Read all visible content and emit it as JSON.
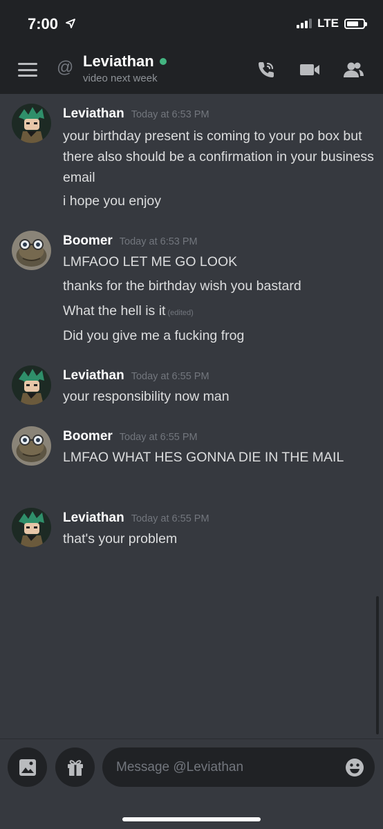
{
  "status_bar": {
    "time": "7:00",
    "network": "LTE"
  },
  "header": {
    "channel_name": "Leviathan",
    "topic": "video next week",
    "at_symbol": "@"
  },
  "messages": [
    {
      "author": "Leviathan",
      "timestamp": "Today at 6:53 PM",
      "lines": [
        "your birthday present is coming to your po box but there also should be a confirmation in your business email",
        "i hope you enjoy"
      ]
    },
    {
      "author": "Boomer",
      "timestamp": "Today at 6:53 PM",
      "lines": [
        "LMFAOO LET ME GO LOOK",
        "thanks for the birthday wish you bastard",
        "What the hell is it",
        "Did you give me a fucking frog"
      ],
      "edited_label": "(edited)"
    },
    {
      "author": "Leviathan",
      "timestamp": "Today at 6:55 PM",
      "lines": [
        "your responsibility now man"
      ]
    },
    {
      "author": "Boomer",
      "timestamp": "Today at 6:55 PM",
      "lines": [
        "LMFAO WHAT HES GONNA DIE IN THE MAIL"
      ]
    },
    {
      "author": "Leviathan",
      "timestamp": "Today at 6:55 PM",
      "lines": [
        "that's your problem"
      ]
    }
  ],
  "composer": {
    "placeholder": "Message @Leviathan"
  },
  "icons": {
    "status": [
      "location-arrow-icon",
      "signal-icon",
      "battery-icon"
    ],
    "header": [
      "menu-icon",
      "at-icon",
      "voice-call-icon",
      "video-call-icon",
      "members-icon"
    ],
    "composer": [
      "image-upload-icon",
      "gift-icon",
      "emoji-icon"
    ]
  },
  "colors": {
    "background": "#36393f",
    "header": "#202225",
    "online": "#43b581",
    "text": "#dcddde",
    "muted": "#72767d",
    "author": "#ffffff"
  }
}
